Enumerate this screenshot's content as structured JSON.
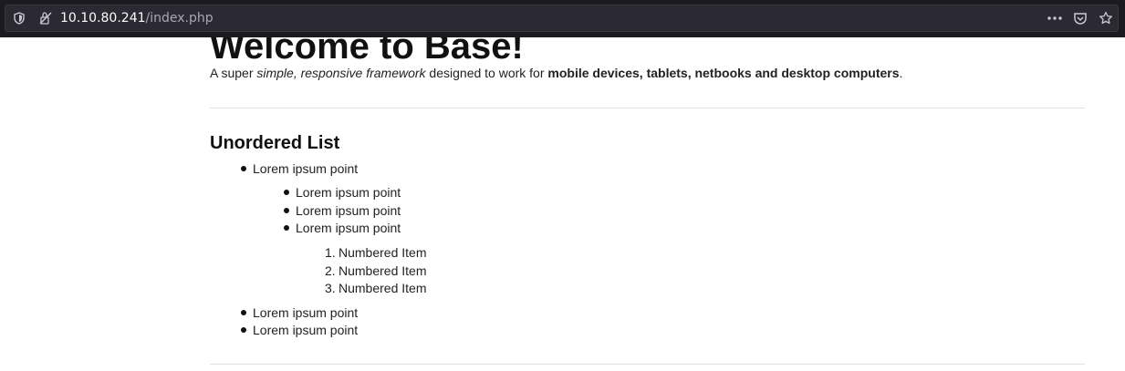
{
  "browser": {
    "url_host": "10.10.80.241",
    "url_path": "/index.php",
    "icons": [
      "shield-icon",
      "site-permissions-icon",
      "more-actions-icon",
      "pocket-icon",
      "bookmark-star-icon"
    ]
  },
  "page": {
    "title": "Welcome to Base!",
    "subtitle": {
      "p1": "A super ",
      "em1": "simple, responsive framework",
      "p2": " designed to work for ",
      "strong1": "mobile devices, tablets, netbooks and desktop computers",
      "p3": "."
    },
    "section_heading": "Unordered List",
    "list": {
      "item1": "Lorem ipsum point",
      "nested": [
        "Lorem ipsum point",
        "Lorem ipsum point",
        "Lorem ipsum point"
      ],
      "ordered": [
        {
          "number": "1.",
          "label": "Numbered Item"
        },
        {
          "number": "2.",
          "label": "Numbered Item"
        },
        {
          "number": "3.",
          "label": "Numbered Item"
        }
      ],
      "tail": [
        "Lorem ipsum point",
        "Lorem ipsum point"
      ]
    }
  },
  "colors": {
    "toolbar_bg": "#1c1b22",
    "urlbar_bg": "#2b2a33",
    "page_bg": "#ffffff",
    "text": "#222222",
    "divider": "#e1e1e1"
  }
}
